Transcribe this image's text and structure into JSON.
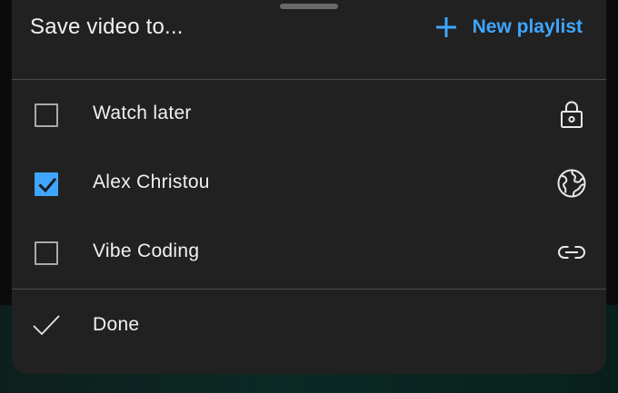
{
  "sheet": {
    "title": "Save video to...",
    "new_playlist": {
      "label": "New playlist",
      "icon": "plus-icon"
    },
    "playlists": [
      {
        "label": "Watch later",
        "checked": false,
        "privacy_icon": "lock-icon"
      },
      {
        "label": "Alex Christou",
        "checked": true,
        "privacy_icon": "globe-icon"
      },
      {
        "label": "Vibe Coding",
        "checked": false,
        "privacy_icon": "link-icon"
      }
    ],
    "done": {
      "label": "Done",
      "icon": "checkmark-icon"
    }
  },
  "colors": {
    "sheet_background": "#212121",
    "accent": "#3ea6ff",
    "text": "#f1f1f1",
    "divider": "#4a4a4a"
  }
}
